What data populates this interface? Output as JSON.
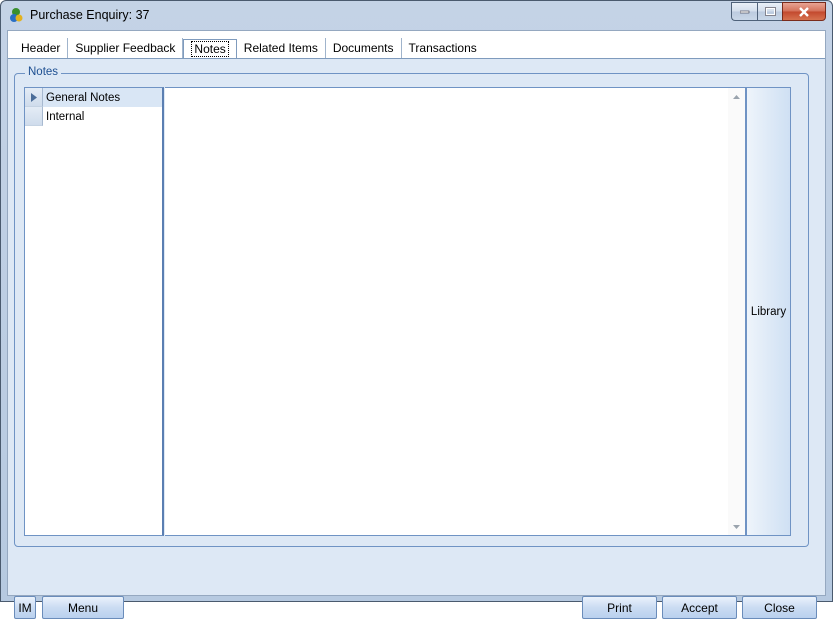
{
  "window": {
    "title": "Purchase Enquiry: 37",
    "icon": "app-logo-icon",
    "caption": {
      "minimize": "minimize-icon",
      "maximize": "maximize-icon",
      "close": "close-icon"
    }
  },
  "tabs": [
    {
      "label": "Header"
    },
    {
      "label": "Supplier Feedback"
    },
    {
      "label": "Notes",
      "active": true
    },
    {
      "label": "Related Items"
    },
    {
      "label": "Documents"
    },
    {
      "label": "Transactions"
    }
  ],
  "notes_group": {
    "legend": "Notes",
    "items": [
      {
        "label": "General Notes",
        "selected": true
      },
      {
        "label": "Internal"
      }
    ],
    "editor_value": "",
    "library_button": "Library"
  },
  "footer": {
    "im_button": "IM",
    "menu_button": "Menu",
    "print_button": "Print",
    "accept_button": "Accept",
    "close_button": "Close"
  },
  "colors": {
    "accent": "#1d4f91",
    "panel": "#dde8f5",
    "border": "#6f93c4"
  }
}
